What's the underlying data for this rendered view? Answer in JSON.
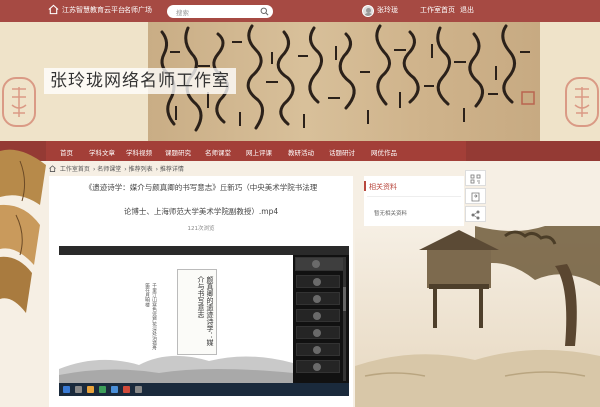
{
  "topbar": {
    "platform": "江苏智慧教育云平台",
    "famous_teacher": "名师广场",
    "search_placeholder": "搜索",
    "username": "张玲珑",
    "workspace": "工作室首页",
    "logout": "退出"
  },
  "banner": {
    "site_title": "张玲珑网络名师工作室"
  },
  "nav": {
    "items": [
      "首页",
      "学科文章",
      "学科视频",
      "课题研究",
      "名师课堂",
      "网上评课",
      "教研活动",
      "话题研讨",
      "网优作品"
    ]
  },
  "breadcrumb": [
    "工作室首页",
    "名师课堂",
    "推荐列表",
    "推荐详情"
  ],
  "video": {
    "title_line1": "《遗迹诗学：媒介与颜真卿的书写意志》丘新巧（中央美术学院书法理",
    "title_line2": "论博士、上海师范大学美术学院副教授）.mp4",
    "views": "121次浏览",
    "slide_title": "颜真卿的遗迹诗学：媒介与书写意志",
    "slide_poem": "千里江山寒色远芦花深处泊孤舟笛在月明楼"
  },
  "related": {
    "title": "相关资料",
    "empty_text": "暂无相关资料"
  },
  "colors": {
    "topbar": "#a64a43",
    "nav": "#a33f38",
    "accent": "#b8473d"
  },
  "icons": {
    "home": "home-icon",
    "search": "search-icon",
    "qrcode": "qrcode-icon",
    "share": "share-icon",
    "scan": "scan-icon"
  }
}
